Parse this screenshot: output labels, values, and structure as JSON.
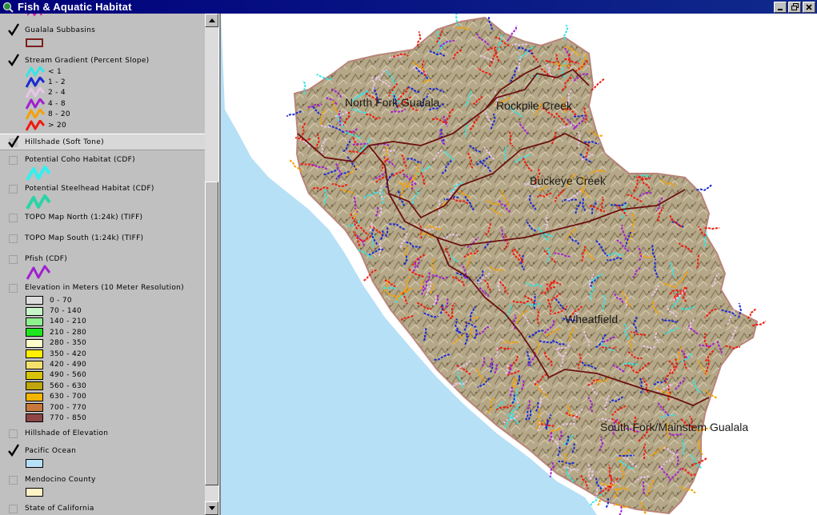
{
  "window": {
    "title": "Fish & Aquatic Habitat",
    "icon": "magnifier-globe-icon",
    "buttons": [
      "minimize",
      "restore",
      "close"
    ]
  },
  "toc": {
    "layers": [
      {
        "name": "Gualala Subbasins",
        "checked": true,
        "symbol": "polygon-outline",
        "outline_color": "#7b1f1f"
      },
      {
        "name": "Stream Gradient (Percent Slope)",
        "checked": true,
        "classes": [
          {
            "label": "< 1",
            "color": "#33e6e6"
          },
          {
            "label": "1 - 2",
            "color": "#1a2ad4"
          },
          {
            "label": "2 - 4",
            "color": "#e8c6ea"
          },
          {
            "label": "4 - 8",
            "color": "#a21fd0"
          },
          {
            "label": "8 - 20",
            "color": "#f5a000"
          },
          {
            "label": "> 20",
            "color": "#ee1c10"
          }
        ]
      },
      {
        "name": "Hillshade (Soft Tone)",
        "checked": true,
        "selected": true
      },
      {
        "name": "Potential Coho Habitat (CDF)",
        "checked": false,
        "line_color": "#33f0f0"
      },
      {
        "name": "Potential Steelhead Habitat (CDF)",
        "checked": false,
        "line_color": "#2ad4a6"
      },
      {
        "name": "TOPO Map North (1:24k) (TIFF)",
        "checked": false
      },
      {
        "name": "TOPO Map South (1:24k) (TIFF)",
        "checked": false
      },
      {
        "name": "Pfish (CDF)",
        "checked": false,
        "line_color": "#a21fd0"
      },
      {
        "name": "Elevation in Meters (10 Meter Resolution)",
        "checked": false,
        "classes": [
          {
            "label": "0 - 70",
            "color": "#dcdcdc"
          },
          {
            "label": "70 - 140",
            "color": "#c8f5c8"
          },
          {
            "label": "140 - 210",
            "color": "#8ff08f"
          },
          {
            "label": "210 - 280",
            "color": "#1ee61e"
          },
          {
            "label": "280 - 350",
            "color": "#fffccc"
          },
          {
            "label": "350 - 420",
            "color": "#fff000"
          },
          {
            "label": "420 - 490",
            "color": "#f5e06e"
          },
          {
            "label": "490 - 560",
            "color": "#d9c20a"
          },
          {
            "label": "560 - 630",
            "color": "#bfa60a"
          },
          {
            "label": "630 - 700",
            "color": "#f5b400"
          },
          {
            "label": "700 - 770",
            "color": "#c8783c"
          },
          {
            "label": "770 - 850",
            "color": "#8c4646"
          }
        ]
      },
      {
        "name": "Hillshade of Elevation",
        "checked": false
      },
      {
        "name": "Pacific Ocean",
        "checked": true,
        "fill": "#b6e0f6"
      },
      {
        "name": "Mendocino County",
        "checked": false,
        "fill": "#fff3c8"
      },
      {
        "name": "State of California",
        "checked": false
      }
    ]
  },
  "map": {
    "ocean_color": "#b6e0f6",
    "terrain_color": "#b5a888",
    "boundary_color": "#6b1010",
    "subbasin_labels": [
      "North Fork Gualala",
      "Rockpile Creek",
      "Buckeye Creek",
      "Wheatfield",
      "South Fork/Mainstem Gualala"
    ]
  }
}
